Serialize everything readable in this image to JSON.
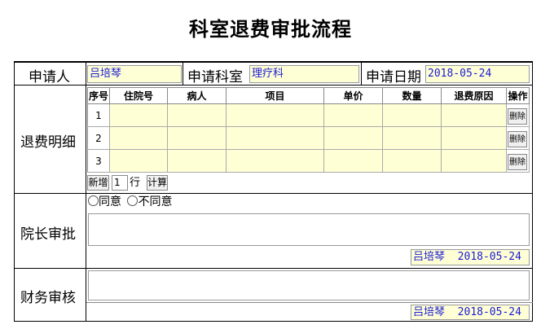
{
  "title": "科室退费审批流程",
  "header": {
    "applicant_label": "申请人",
    "applicant_value": "吕培琴",
    "dept_label": "申请科室",
    "dept_value": "理疗科",
    "date_label": "申请日期",
    "date_value": "2018-05-24"
  },
  "detail": {
    "section_label": "退费明细",
    "columns": [
      "序号",
      "住院号",
      "病人",
      "项目",
      "单价",
      "数量",
      "退费原因",
      "操作"
    ],
    "rows": [
      {
        "index": "1",
        "delete_label": "删除"
      },
      {
        "index": "2",
        "delete_label": "删除"
      },
      {
        "index": "3",
        "delete_label": "删除"
      }
    ],
    "add_label": "新增",
    "add_count": "1",
    "row_unit": "行",
    "calc_label": "计算"
  },
  "director": {
    "section_label": "院长审批",
    "agree_label": "同意",
    "disagree_label": "不同意",
    "signer": "吕培琴",
    "sign_date": "2018-05-24"
  },
  "finance": {
    "section_label": "财务审核",
    "signer": "吕培琴",
    "sign_date": "2018-05-24"
  }
}
